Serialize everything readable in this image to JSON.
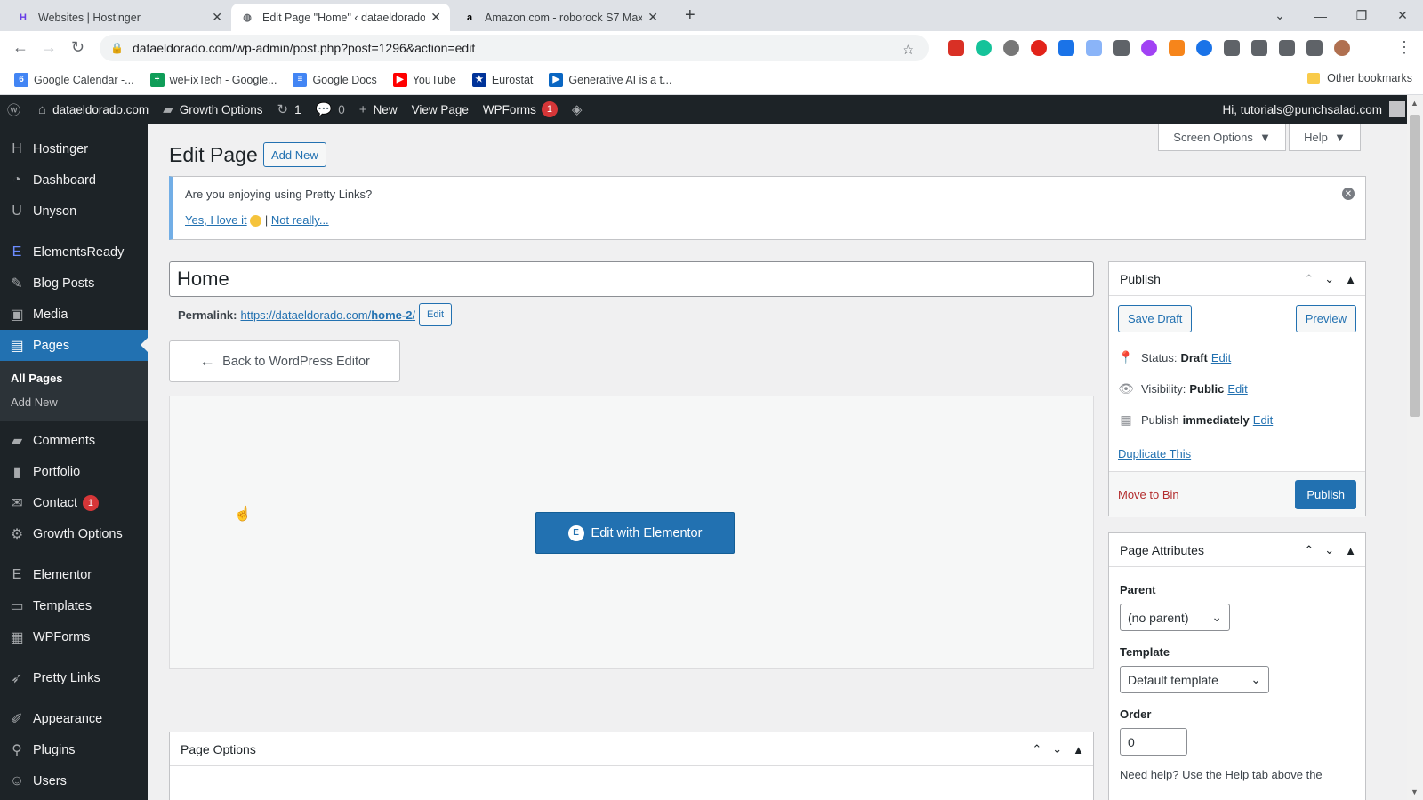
{
  "browser": {
    "tabs": [
      {
        "title": "Websites | Hostinger",
        "icon": "hostinger-icon"
      },
      {
        "title": "Edit Page \"Home\" ‹ dataeldorado",
        "icon": "wordpress-icon"
      },
      {
        "title": "Amazon.com - roborock S7 Max",
        "icon": "amazon-icon"
      }
    ],
    "url": "dataeldorado.com/wp-admin/post.php?post=1296&action=edit",
    "bookmarks": [
      {
        "label": "Google Calendar -...",
        "color": "#4285f4",
        "glyph": "6"
      },
      {
        "label": "weFixTech - Google...",
        "color": "#0f9d58",
        "glyph": "+"
      },
      {
        "label": "Google Docs",
        "color": "#4285f4",
        "glyph": "≡"
      },
      {
        "label": "YouTube",
        "color": "#ff0000",
        "glyph": "▶"
      },
      {
        "label": "Eurostat",
        "color": "#003399",
        "glyph": "★"
      },
      {
        "label": "Generative AI is a t...",
        "color": "#0a66c2",
        "glyph": "▶"
      }
    ],
    "other_bookmarks": "Other bookmarks"
  },
  "adminbar": {
    "site": "dataeldorado.com",
    "growth": "Growth Options",
    "updates": "1",
    "comments": "0",
    "new": "New",
    "view": "View Page",
    "wpforms": "WPForms",
    "wpforms_badge": "1",
    "greeting": "Hi, tutorials@punchsalad.com"
  },
  "sidebar": {
    "items": [
      {
        "label": "Hostinger",
        "icon": "H"
      },
      {
        "label": "Dashboard",
        "icon": "◔"
      },
      {
        "label": "Unyson",
        "icon": "U"
      },
      {
        "label": "ElementsReady",
        "icon": "E"
      },
      {
        "label": "Blog Posts",
        "icon": "✎"
      },
      {
        "label": "Media",
        "icon": "▣"
      },
      {
        "label": "Pages",
        "icon": "▤"
      },
      {
        "label": "Comments",
        "icon": "▰"
      },
      {
        "label": "Portfolio",
        "icon": "▮"
      },
      {
        "label": "Contact",
        "icon": "✉",
        "badge": "1"
      },
      {
        "label": "Growth Options",
        "icon": "⚙"
      },
      {
        "label": "Elementor",
        "icon": "E"
      },
      {
        "label": "Templates",
        "icon": "▭"
      },
      {
        "label": "WPForms",
        "icon": "▦"
      },
      {
        "label": "Pretty Links",
        "icon": "➶"
      },
      {
        "label": "Appearance",
        "icon": "✐"
      },
      {
        "label": "Plugins",
        "icon": "⚲"
      },
      {
        "label": "Users",
        "icon": "☺"
      }
    ],
    "submenu": [
      "All Pages",
      "Add New"
    ]
  },
  "main": {
    "screen_options": "Screen Options",
    "help": "Help",
    "title": "Edit Page",
    "add_new": "Add New",
    "notice_question": "Are you enjoying using Pretty Links?",
    "notice_yes": "Yes, I love it",
    "notice_no": "Not really...",
    "post_title": "Home",
    "permalink_label": "Permalink:",
    "permalink_url": "https://dataeldorado.com/",
    "permalink_slug": "home-2",
    "permalink_end": "/",
    "permalink_edit": "Edit",
    "back_editor": "Back to WordPress Editor",
    "edit_elementor": "Edit with Elementor",
    "page_options": "Page Options"
  },
  "publish": {
    "title": "Publish",
    "save_draft": "Save Draft",
    "preview": "Preview",
    "status_label": "Status:",
    "status_value": "Draft",
    "visibility_label": "Visibility:",
    "visibility_value": "Public",
    "publish_label": "Publish",
    "publish_value": "immediately",
    "edit": "Edit",
    "duplicate": "Duplicate This",
    "move_to_bin": "Move to Bin",
    "publish_btn": "Publish"
  },
  "attributes": {
    "title": "Page Attributes",
    "parent_label": "Parent",
    "parent_value": "(no parent)",
    "template_label": "Template",
    "template_value": "Default template",
    "order_label": "Order",
    "order_value": "0",
    "help": "Need help? Use the Help tab above the"
  }
}
